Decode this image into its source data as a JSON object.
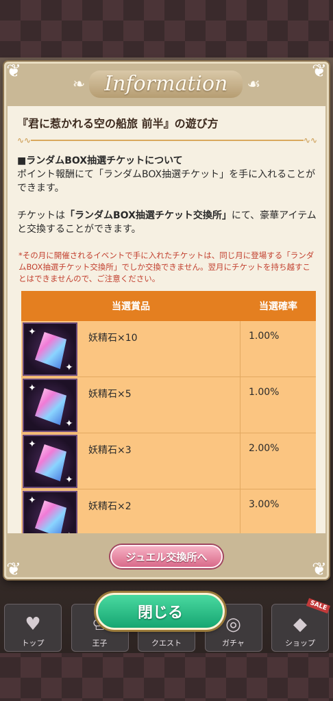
{
  "modal": {
    "header_title": "Information",
    "heading": "『君に惹かれる空の船旅 前半』の遊び方",
    "section_title": "■ランダムBOX抽選チケットについて",
    "para1": "ポイント報酬にて「ランダムBOX抽選チケット」を手に入れることができます。",
    "para2_prefix": "チケットは",
    "para2_bold": "「ランダムBOX抽選チケット交換所」",
    "para2_suffix": "にて、豪華アイテムと交換することができます。",
    "note": "*その月に開催されるイベントで手に入れたチケットは、同じ月に登場する「ランダムBOX抽選チケット交換所」でしか交換できません。翌月にチケットを持ち越すことはできませんので、ご注意ください。",
    "table": {
      "col_prize": "当選賞品",
      "col_rate": "当選確率",
      "rows": [
        {
          "name": "妖精石×10",
          "rate": "1.00%"
        },
        {
          "name": "妖精石×5",
          "rate": "1.00%"
        },
        {
          "name": "妖精石×3",
          "rate": "2.00%"
        },
        {
          "name": "妖精石×2",
          "rate": "3.00%"
        }
      ]
    },
    "jewel_button": "ジュエル交換所へ",
    "close_button": "閉じる"
  },
  "nav": {
    "items": [
      {
        "label": "トップ",
        "icon": "heart-icon"
      },
      {
        "label": "王子",
        "icon": "crown-icon"
      },
      {
        "label": "クエスト",
        "icon": "swords-icon"
      },
      {
        "label": "ガチャ",
        "icon": "gacha-icon"
      },
      {
        "label": "ショップ",
        "icon": "gem-icon",
        "badge": "SALE"
      }
    ]
  }
}
